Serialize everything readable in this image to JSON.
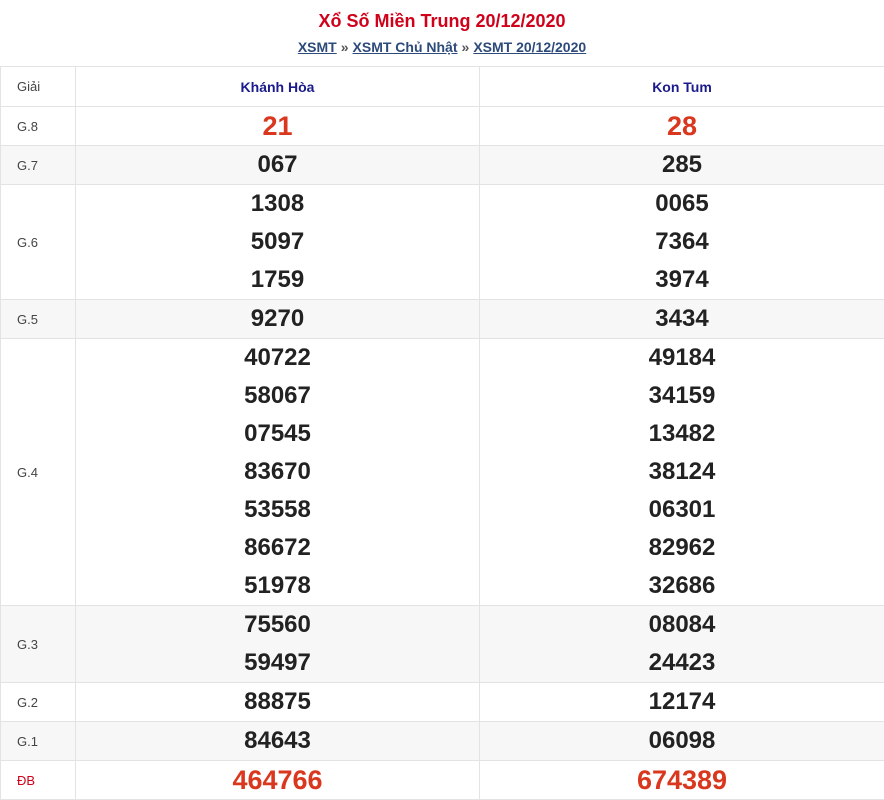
{
  "header": {
    "title": "Xổ Số Miền Trung 20/12/2020",
    "breadcrumb": [
      "XSMT",
      "XSMT Chủ Nhật",
      "XSMT 20/12/2020"
    ],
    "separator": "»"
  },
  "table": {
    "giai_label": "Giải",
    "provinces": [
      "Khánh Hòa",
      "Kon Tum"
    ],
    "rows": [
      {
        "label": "G.8",
        "values": [
          [
            "21"
          ],
          [
            "28"
          ]
        ],
        "highlight": true
      },
      {
        "label": "G.7",
        "values": [
          [
            "067"
          ],
          [
            "285"
          ]
        ]
      },
      {
        "label": "G.6",
        "values": [
          [
            "1308",
            "5097",
            "1759"
          ],
          [
            "0065",
            "7364",
            "3974"
          ]
        ]
      },
      {
        "label": "G.5",
        "values": [
          [
            "9270"
          ],
          [
            "3434"
          ]
        ]
      },
      {
        "label": "G.4",
        "values": [
          [
            "40722",
            "58067",
            "07545",
            "83670",
            "53558",
            "86672",
            "51978"
          ],
          [
            "49184",
            "34159",
            "13482",
            "38124",
            "06301",
            "82962",
            "32686"
          ]
        ]
      },
      {
        "label": "G.3",
        "values": [
          [
            "75560",
            "59497"
          ],
          [
            "08084",
            "24423"
          ]
        ]
      },
      {
        "label": "G.2",
        "values": [
          [
            "88875"
          ],
          [
            "12174"
          ]
        ]
      },
      {
        "label": "G.1",
        "values": [
          [
            "84643"
          ],
          [
            "06098"
          ]
        ]
      },
      {
        "label": "ĐB",
        "values": [
          [
            "464766"
          ],
          [
            "674389"
          ]
        ],
        "highlight": true
      }
    ]
  },
  "colors": {
    "title": "#d0021b",
    "highlight": "#d9381e",
    "link": "#2c4a7a",
    "province": "#1a1a8c"
  }
}
